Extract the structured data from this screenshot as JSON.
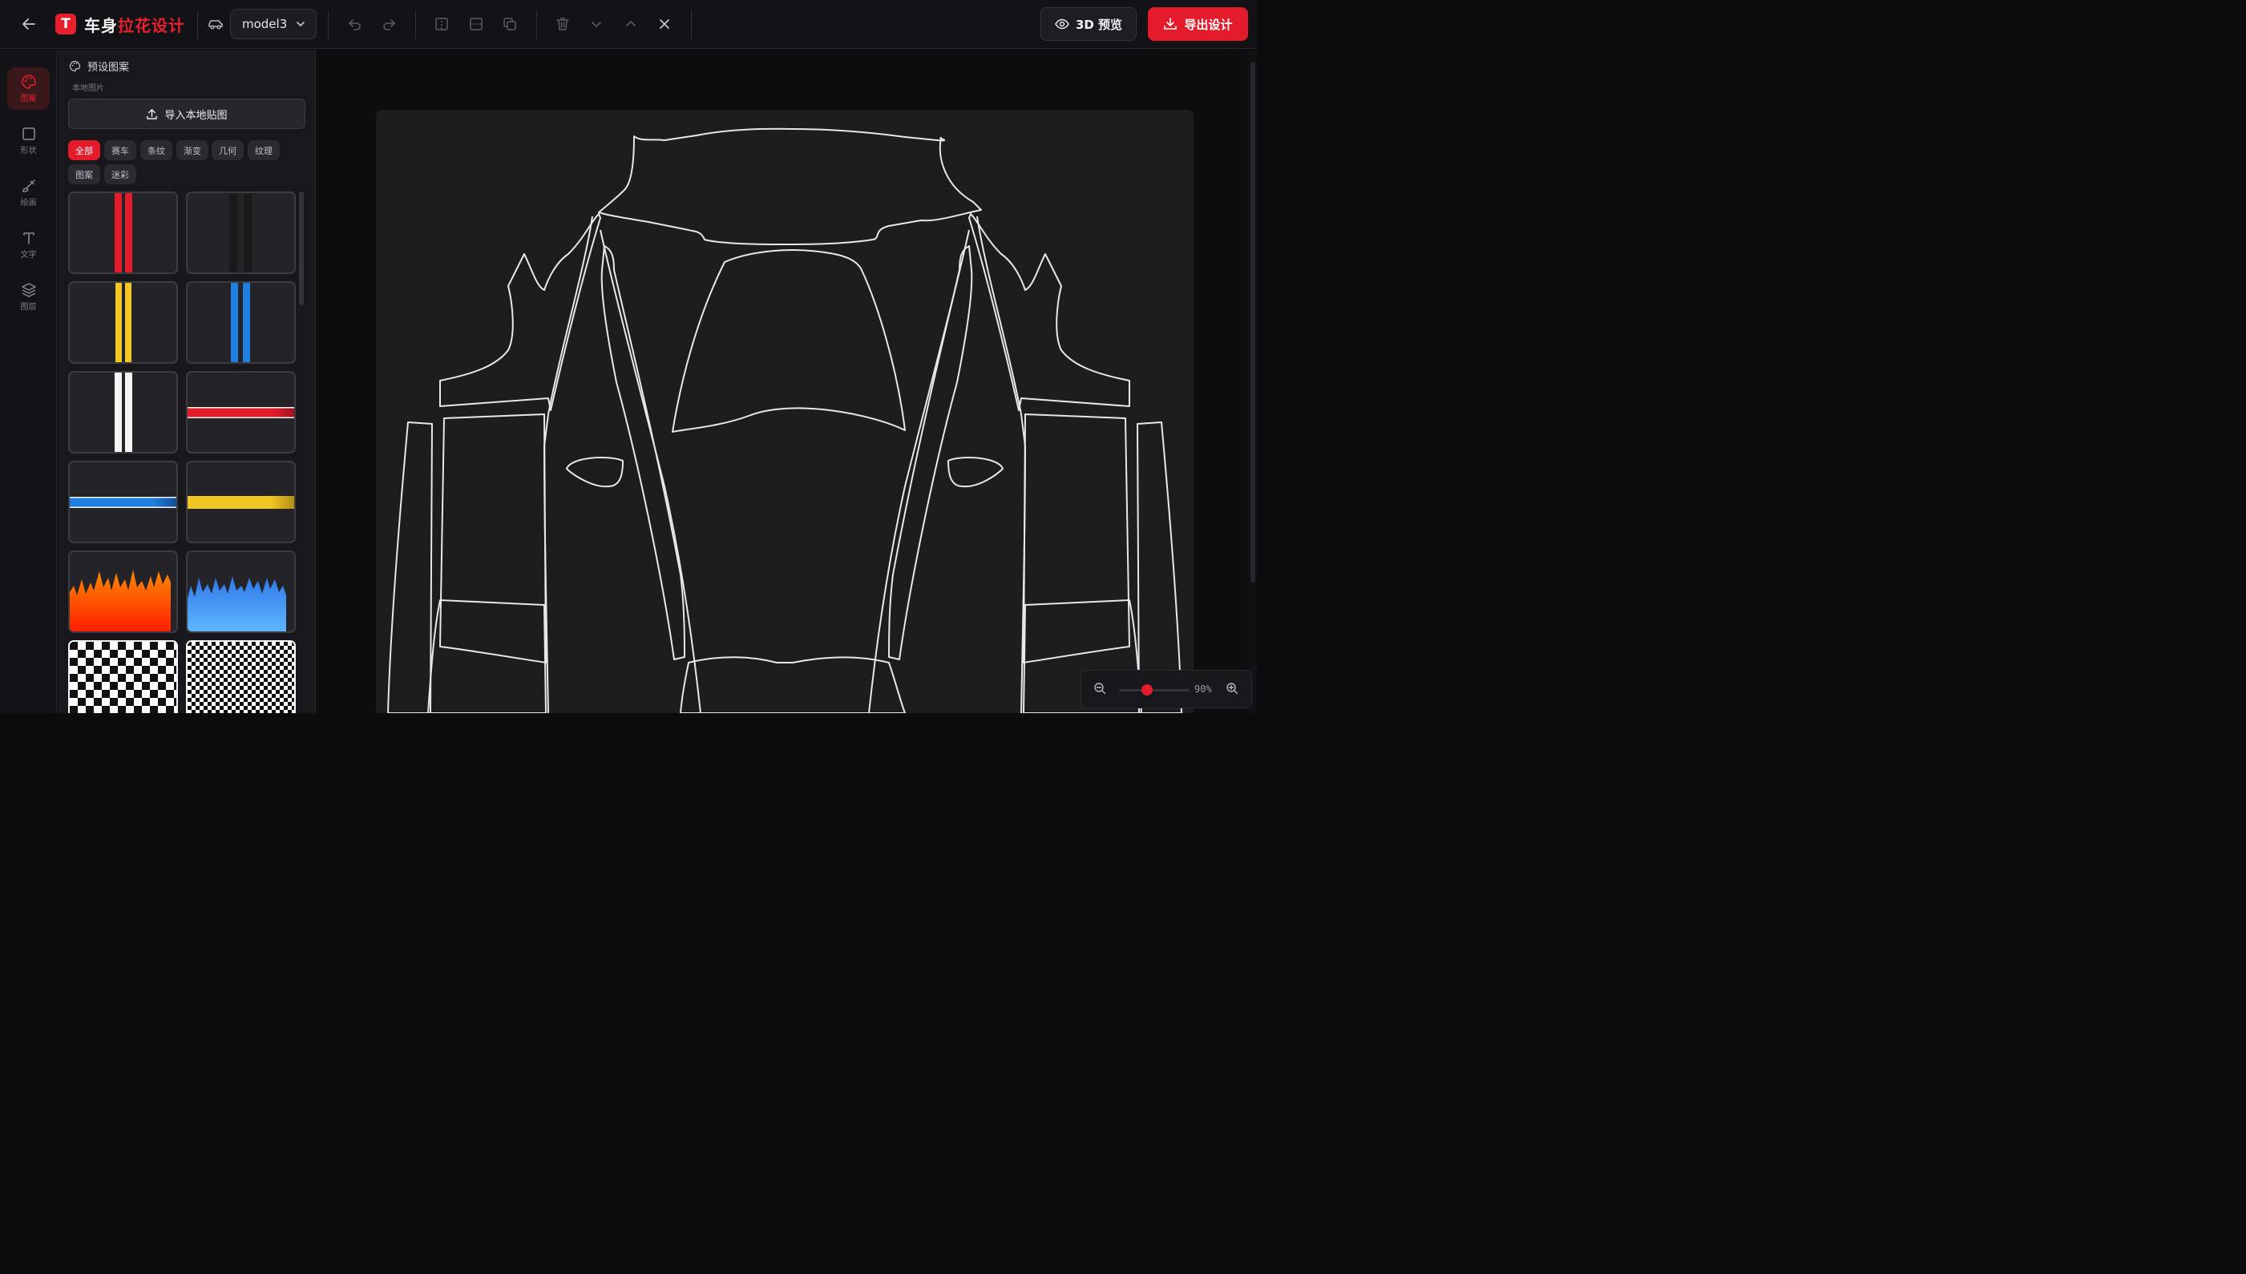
{
  "app": {
    "logo_letter": "T",
    "title_main": "车身",
    "title_accent": "拉花设计",
    "accent_color": "#e31b2b"
  },
  "toolbar": {
    "model_selected": "model3",
    "tools": [
      "undo-icon",
      "redo-icon",
      "flip-horizontal-icon",
      "flip-vertical-icon",
      "duplicate-icon",
      "trash-icon",
      "layer-down-icon",
      "layer-up-icon",
      "close-icon"
    ],
    "preview_label": "3D 预览",
    "export_label": "导出设计"
  },
  "rail": {
    "items": [
      {
        "label": "图案",
        "icon": "palette-icon",
        "active": true
      },
      {
        "label": "形状",
        "icon": "square-icon",
        "active": false
      },
      {
        "label": "绘画",
        "icon": "brush-icon",
        "active": false
      },
      {
        "label": "文字",
        "icon": "text-icon",
        "active": false
      },
      {
        "label": "图层",
        "icon": "layers-icon",
        "active": false
      }
    ]
  },
  "panel": {
    "title": "预设图案",
    "subtitle": "本地图片",
    "import_label": "导入本地贴图",
    "categories": [
      "全部",
      "赛车",
      "条纹",
      "渐变",
      "几何",
      "纹理",
      "图案",
      "迷彩"
    ],
    "active_category": "全部",
    "patterns": [
      {
        "name": "red-racing-stripes"
      },
      {
        "name": "black-racing-stripes"
      },
      {
        "name": "yellow-racing-stripes"
      },
      {
        "name": "blue-racing-stripes"
      },
      {
        "name": "white-racing-stripes"
      },
      {
        "name": "red-side-stripe"
      },
      {
        "name": "blue-side-stripe"
      },
      {
        "name": "yellow-side-stripe"
      },
      {
        "name": "orange-flames"
      },
      {
        "name": "blue-flames"
      },
      {
        "name": "large-checker"
      },
      {
        "name": "small-checker"
      }
    ]
  },
  "zoom": {
    "value_label": "90%",
    "level": 0.4
  }
}
